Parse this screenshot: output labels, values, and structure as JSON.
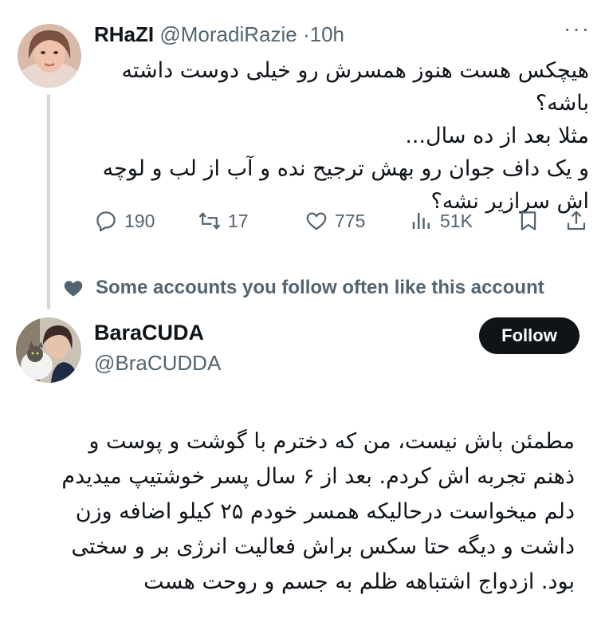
{
  "tweet1": {
    "name": "RHaZI",
    "handle": "@MoradiRazie",
    "separator": "·",
    "time": "10h",
    "more_icon": "ellipsis-icon",
    "text_lines": [
      "هیچکس هست هنوز همسرش رو خیلی دوست داشته",
      "باشه؟",
      "مثلا بعد از ده سال...",
      "و یک داف جوان رو بهش ترجیح نده و آب از لب و لوچه",
      "اش سرازیر نشه؟"
    ],
    "actions": {
      "replies": "190",
      "reposts": "17",
      "likes": "775",
      "views": "51K"
    }
  },
  "social_context": {
    "icon": "heart-icon",
    "text": "Some accounts you follow often like this account"
  },
  "tweet2": {
    "name": "BaraCUDA",
    "handle": "@BraCUDDA",
    "follow_label": "Follow",
    "text_lines": [
      "مطمئن باش نیست، من که دخترم با گوشت و پوست و",
      "ذهنم تجربه اش کردم. بعد از ۶ سال پسر خوشتیپ میدیدم",
      "دلم میخواست درحالیکه همسر خودم ۲۵ کیلو اضافه وزن",
      "داشت و دیگه حتا سکس براش فعالیت انرژی بر و سختی",
      "بود. ازدواج اشتباهه ظلم به جسم و روحت هست"
    ]
  },
  "colors": {
    "text": "#0f1419",
    "secondary": "#536471",
    "thread": "#cfd9de",
    "button_bg": "#0f1419"
  }
}
